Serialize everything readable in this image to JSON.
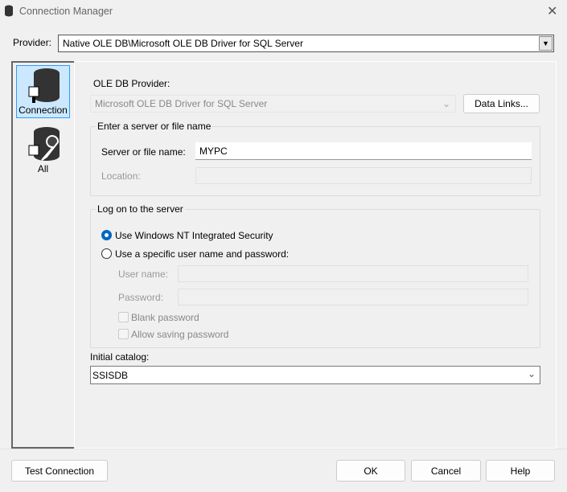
{
  "window": {
    "title": "Connection Manager",
    "close": "✕"
  },
  "provider": {
    "label": "Provider:",
    "value": "Native OLE DB\\Microsoft OLE DB Driver for SQL Server"
  },
  "nav": [
    {
      "label": "Connection",
      "icon": "database-plug-icon",
      "selected": true
    },
    {
      "label": "All",
      "icon": "database-plug-wrench-icon",
      "selected": false
    }
  ],
  "ole": {
    "label": "OLE DB Provider:",
    "value": "Microsoft OLE DB Driver for SQL Server",
    "data_links": "Data Links..."
  },
  "server_group": {
    "title": "Enter a server or file name",
    "server_label": "Server or file name:",
    "server_value": "MYPC",
    "location_label": "Location:"
  },
  "logon": {
    "title": "Log on to the server",
    "opt_windows": "Use Windows NT Integrated Security",
    "opt_specific": "Use a specific user name and password:",
    "user_label": "User name:",
    "password_label": "Password:",
    "blank_password": "Blank password",
    "allow_saving": "Allow saving password"
  },
  "catalog": {
    "label": "Initial catalog:",
    "value": "SSISDB"
  },
  "buttons": {
    "test": "Test Connection",
    "ok": "OK",
    "cancel": "Cancel",
    "help": "Help"
  },
  "colors": {
    "selected_bg": "#cce8ff",
    "accent": "#0067c0"
  }
}
